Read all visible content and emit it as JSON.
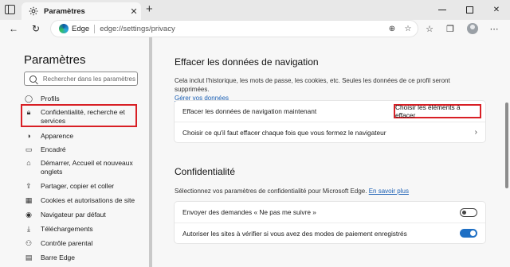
{
  "browser": {
    "tab_title": "Paramètres",
    "site_label": "Edge",
    "url": "edge://settings/privacy"
  },
  "sidebar": {
    "title": "Paramètres",
    "search_placeholder": "Rechercher dans les paramètres",
    "items": [
      {
        "label": "Profils",
        "icon": "profile-icon"
      },
      {
        "label": "Confidentialité, recherche et services",
        "icon": "lock-icon",
        "active": true
      },
      {
        "label": "Apparence",
        "icon": "appearance-icon"
      },
      {
        "label": "Encadré",
        "icon": "sidebar-icon"
      },
      {
        "label": "Démarrer, Accueil et nouveaux onglets",
        "icon": "home-icon"
      },
      {
        "label": "Partager, copier et coller",
        "icon": "share-icon"
      },
      {
        "label": "Cookies et autorisations de site",
        "icon": "cookie-icon"
      },
      {
        "label": "Navigateur par défaut",
        "icon": "browser-icon"
      },
      {
        "label": "Téléchargements",
        "icon": "download-icon"
      },
      {
        "label": "Contrôle parental",
        "icon": "family-icon"
      },
      {
        "label": "Barre Edge",
        "icon": "edge-bar-icon"
      }
    ]
  },
  "clear_data": {
    "heading": "Effacer les données de navigation",
    "description": "Cela inclut l'historique, les mots de passe, les cookies, etc. Seules les données de ce profil seront supprimées.",
    "manage_link": "Gérer vos données",
    "row_clear_now": "Effacer les données de navigation maintenant",
    "choose_button": "Choisir les éléments à effacer",
    "row_on_close": "Choisir ce qu'il faut effacer chaque fois que vous fermez le navigateur"
  },
  "privacy": {
    "heading": "Confidentialité",
    "description": "Sélectionnez vos paramètres de confidentialité pour Microsoft Edge.",
    "learn_more": "En savoir plus",
    "do_not_track": {
      "label": "Envoyer des demandes « Ne pas me suivre »",
      "enabled": false
    },
    "payment_methods": {
      "label": "Autoriser les sites à vérifier si vous avez des modes de paiement enregistrés",
      "enabled": true
    }
  },
  "colors": {
    "accent": "#1e6fc4",
    "highlight_border": "#d81f25",
    "link": "#1a5fb4"
  }
}
